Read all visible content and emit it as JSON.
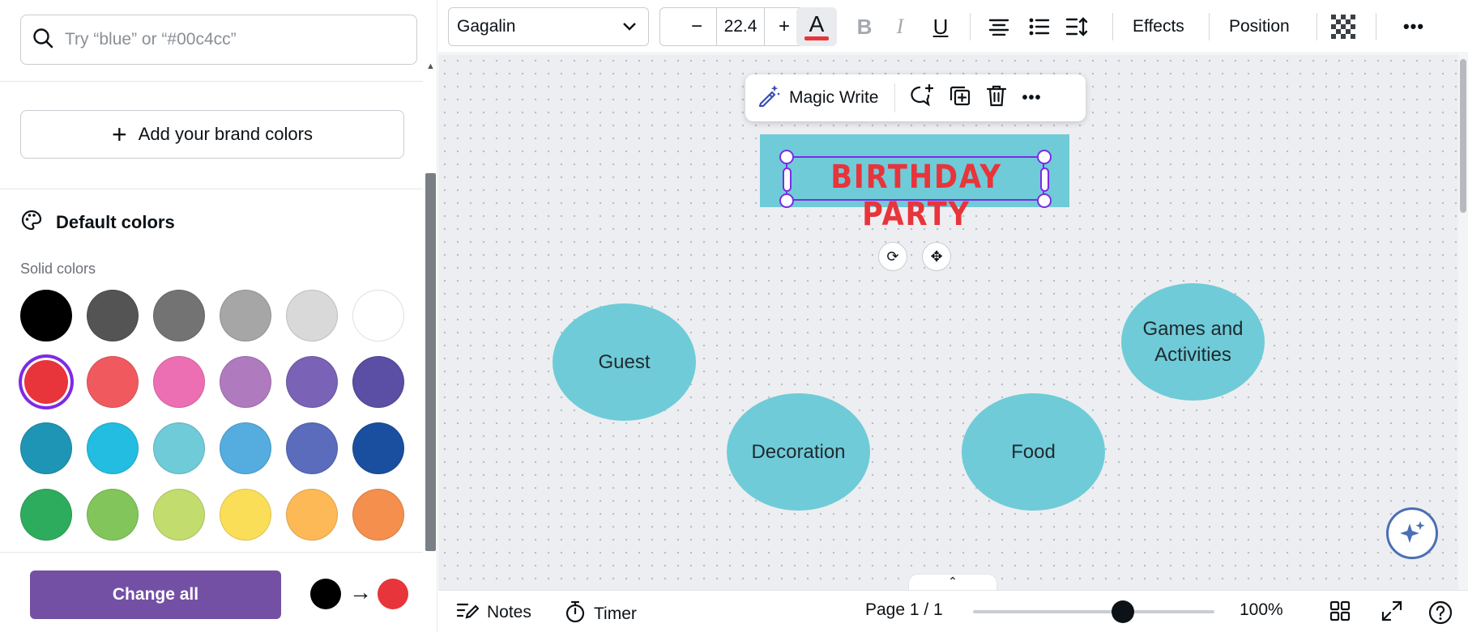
{
  "panel": {
    "search_placeholder": "Try “blue” or “#00c4cc”",
    "add_brand_colors": "Add your brand colors",
    "default_colors_title": "Default colors",
    "solid_colors_label": "Solid colors",
    "swatches": [
      [
        "#000000",
        "#545454",
        "#737373",
        "#a6a6a6",
        "#d9d9d9",
        "#ffffff"
      ],
      [
        "#e8343b",
        "#f05a5f",
        "#ec6fb3",
        "#b07abf",
        "#7a62b6",
        "#5a4ea5"
      ],
      [
        "#1f95b5",
        "#22bde0",
        "#6fcbd7",
        "#54acdf",
        "#5a6cbb",
        "#1a4fa0"
      ],
      [
        "#2eac5d",
        "#82c55b",
        "#c2dc6e",
        "#fbde57",
        "#fdb956",
        "#f48f4d"
      ]
    ],
    "selected_swatch": "#e8343b",
    "change_all_label": "Change all",
    "change_from_color": "#000000",
    "change_to_color": "#e8343b"
  },
  "toolbar": {
    "font_name": "Gagalin",
    "minus": "−",
    "font_size": "22.4",
    "plus": "+",
    "text_color_letter": "A",
    "bold": "B",
    "italic": "I",
    "underline": "U",
    "effects_label": "Effects",
    "position_label": "Position",
    "more": "•••"
  },
  "context_bar": {
    "magic_write_label": "Magic Write",
    "more": "•••"
  },
  "canvas": {
    "title_text": "BIRTHDAY PARTY",
    "nodes": {
      "guest": "Guest",
      "decoration": "Decoration",
      "food": "Food",
      "games_line1": "Games and",
      "games_line2": "Activities"
    }
  },
  "bottom_bar": {
    "notes_label": "Notes",
    "timer_label": "Timer",
    "page_indicator": "Page 1 / 1",
    "zoom_level": "100%",
    "zoom_fraction": 0.62
  }
}
